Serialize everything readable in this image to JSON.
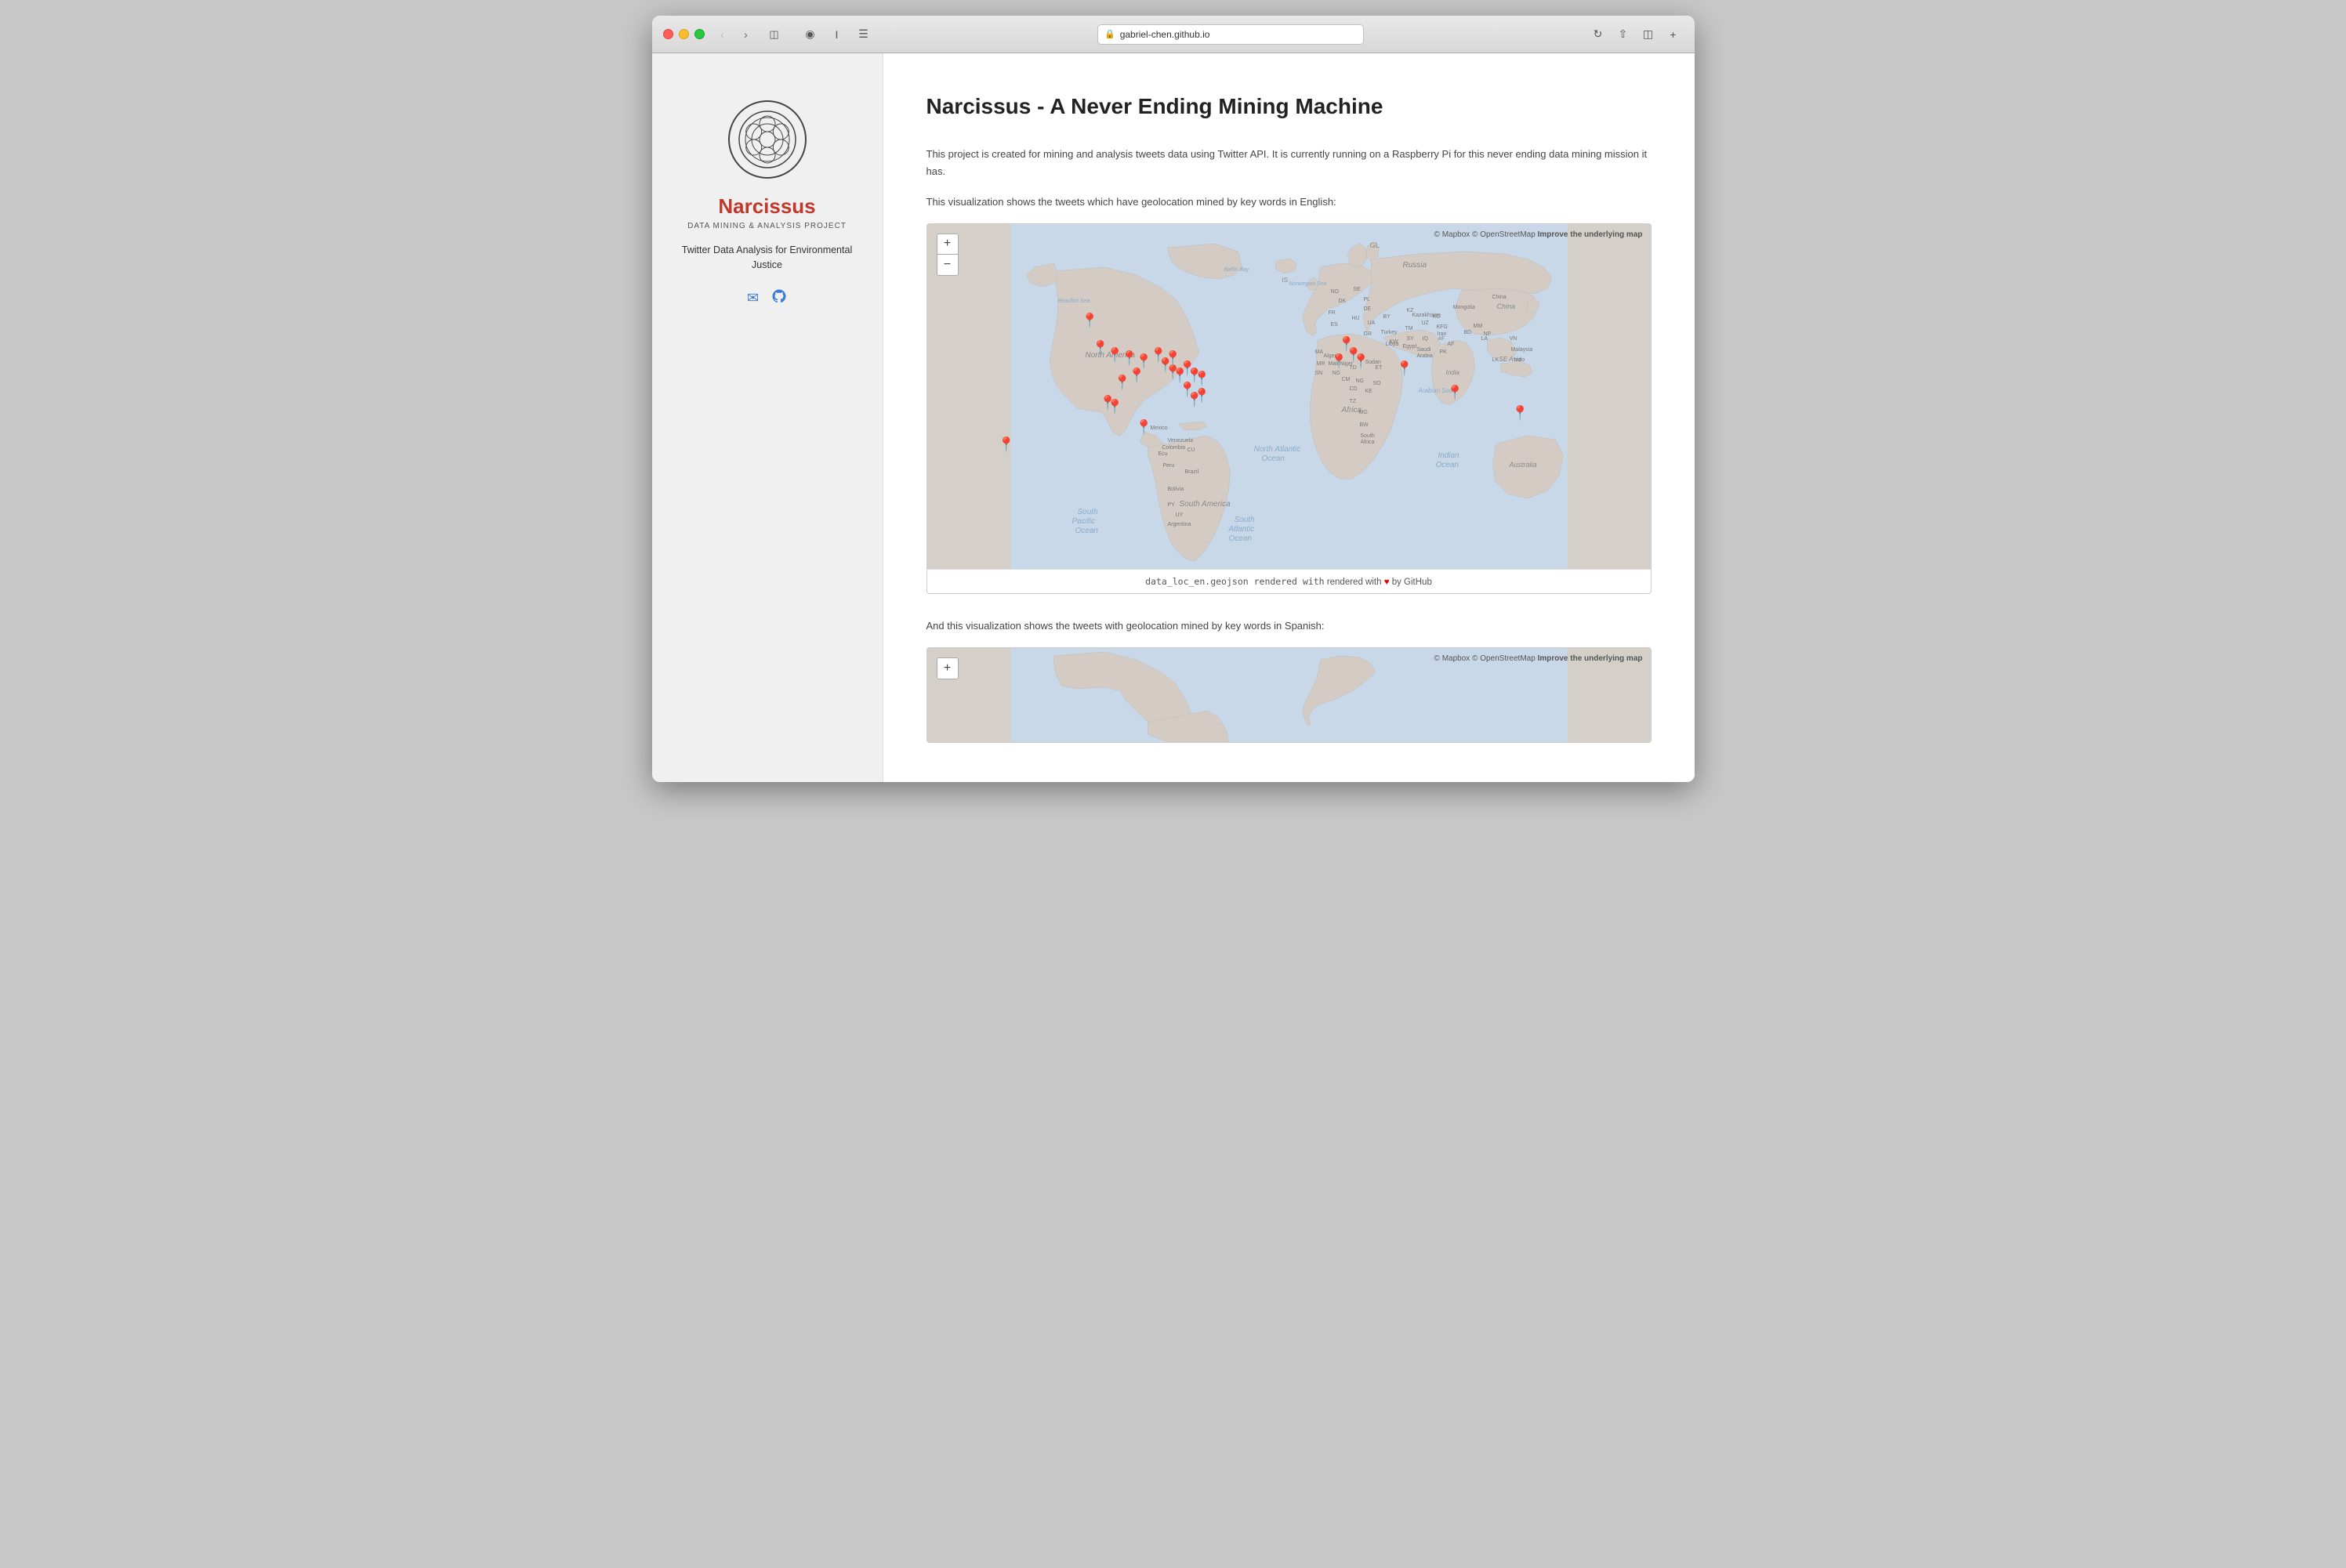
{
  "browser": {
    "url": "gabriel-chen.github.io",
    "back_disabled": true,
    "forward_disabled": false
  },
  "sidebar": {
    "logo_alt": "Narcissus Logo",
    "title": "Narcissus",
    "subtitle": "DATA MINING & ANALYSIS PROJECT",
    "tagline": "Twitter Data Analysis for Environmental Justice",
    "email_label": "email",
    "github_label": "github"
  },
  "main": {
    "page_title": "Narcissus - A Never Ending Mining Machine",
    "intro_paragraph1": "This project is created for mining and analysis tweets data using Twitter API. It is currently running on a Raspberry Pi for this never ending data mining mission it has.",
    "intro_paragraph2": "This visualization shows the tweets which have geolocation mined by key words in English:",
    "map1": {
      "attribution": "© Mapbox © OpenStreetMap",
      "attribution_link": "Improve the underlying map",
      "footer_text": "data_loc_en.geojson rendered with",
      "footer_by": "by GitHub",
      "zoom_in": "+",
      "zoom_out": "−"
    },
    "second_viz_label": "And this visualization shows the tweets with geolocation mined by key words in Spanish:",
    "map2": {
      "attribution": "© Mapbox © OpenStreetMap",
      "attribution_link": "Improve the underlying map"
    }
  }
}
